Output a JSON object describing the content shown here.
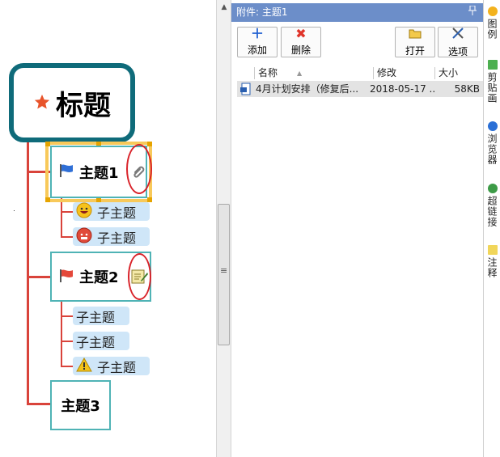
{
  "mindmap": {
    "root": {
      "label": "标题",
      "icon": "star-icon"
    },
    "topics": [
      {
        "label": "主题1",
        "marker": "blue-flag-icon",
        "badge": "paperclip-icon",
        "subtopics": [
          {
            "label": "子主题",
            "icon": "smiley-laugh-icon"
          },
          {
            "label": "子主题",
            "icon": "smiley-angry-icon"
          }
        ]
      },
      {
        "label": "主题2",
        "marker": "red-flag-icon",
        "badge": "note-icon",
        "subtopics": [
          {
            "label": "子主题"
          },
          {
            "label": "子主题"
          },
          {
            "label": "子主题",
            "icon": "warning-icon"
          }
        ]
      },
      {
        "label": "主题3"
      }
    ],
    "colors": {
      "branch": "#d9433b",
      "root_border": "#0f6b7a",
      "topic_border": "#4fb3b5",
      "subtopic_fill": "#cfe6f8",
      "selection": "#f8c95a",
      "annotation": "#d9232a"
    }
  },
  "splitter": {
    "grip": "≡"
  },
  "attachments": {
    "title": "附件: 主题1",
    "toolbar": {
      "add": "添加",
      "delete": "删除",
      "open": "打开",
      "options": "选项"
    },
    "columns": {
      "name": "名称",
      "modified": "修改",
      "size": "大小"
    },
    "rows": [
      {
        "name": "4月计划安排（修复后...",
        "modified": "2018-05-17 ...",
        "size": "58KB"
      }
    ],
    "colors": {
      "header_bg": "#6c8ec9"
    }
  },
  "side_tabs": [
    {
      "label": "图例"
    },
    {
      "label": "剪贴画"
    },
    {
      "label": "浏览器"
    },
    {
      "label": "超链接"
    },
    {
      "label": "注释"
    }
  ]
}
